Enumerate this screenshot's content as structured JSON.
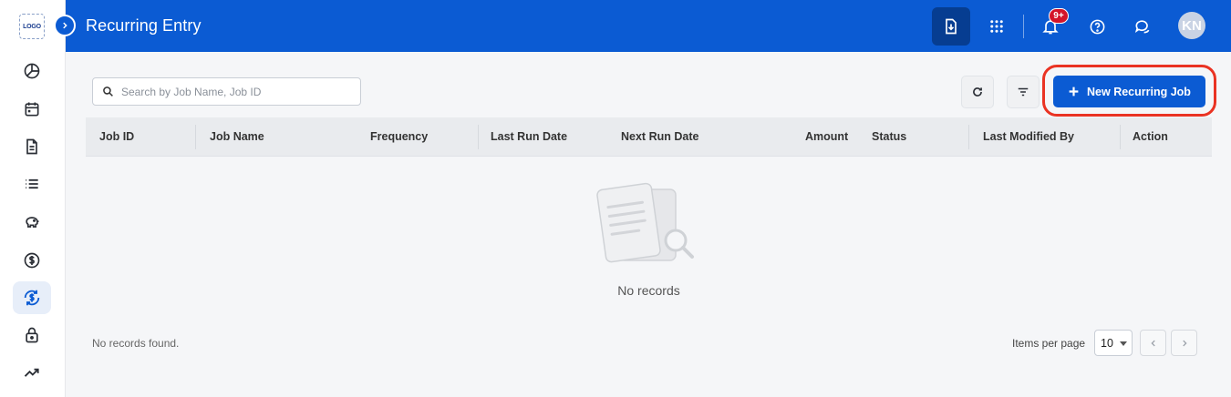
{
  "sidebar": {
    "logo_text": "LOGO",
    "items": [
      {
        "name": "dashboard",
        "icon": "pie-chart-icon"
      },
      {
        "name": "calendar",
        "icon": "calendar-icon"
      },
      {
        "name": "documents",
        "icon": "document-icon"
      },
      {
        "name": "list",
        "icon": "list-icon"
      },
      {
        "name": "savings",
        "icon": "piggy-bank-icon"
      },
      {
        "name": "payments",
        "icon": "dollar-circle-icon"
      },
      {
        "name": "recurring",
        "icon": "recurring-dollar-icon",
        "active": true
      },
      {
        "name": "security",
        "icon": "lock-icon"
      },
      {
        "name": "trends",
        "icon": "trending-up-icon"
      }
    ]
  },
  "header": {
    "title": "Recurring Entry",
    "notification_badge": "9+",
    "avatar_initials": "KN",
    "brand_color": "#0b5bd3"
  },
  "toolbar": {
    "search_placeholder": "Search by Job Name, Job ID",
    "new_button_label": "New Recurring Job",
    "highlight_color": "#ea3323"
  },
  "table": {
    "columns": [
      "Job ID",
      "Job Name",
      "Frequency",
      "Last Run Date",
      "Next Run Date",
      "Amount",
      "Status",
      "Last Modified By",
      "Action"
    ],
    "rows": [],
    "empty_message": "No records"
  },
  "footer": {
    "status_text": "No records found.",
    "items_per_page_label": "Items per page",
    "items_per_page_value": "10"
  }
}
